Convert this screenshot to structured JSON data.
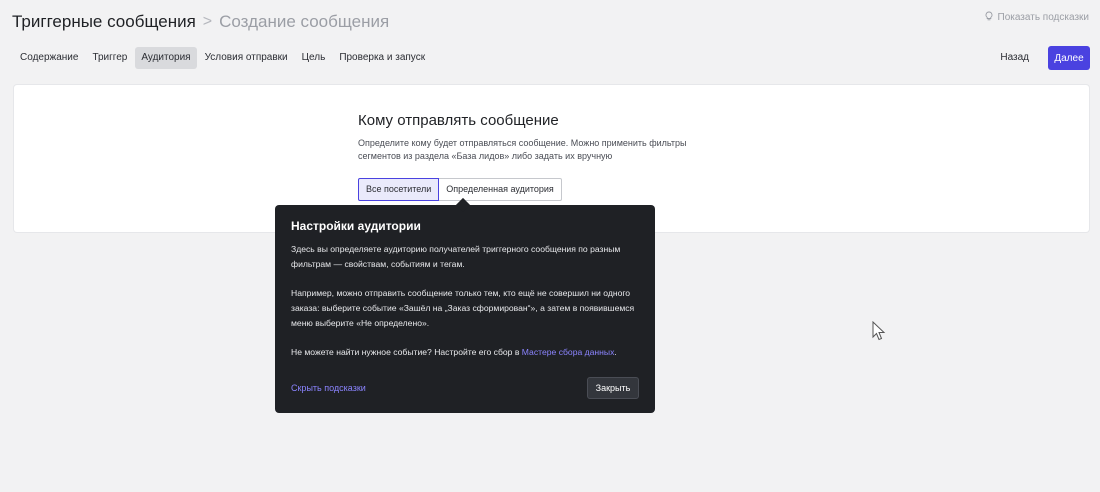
{
  "header": {
    "title": "Триггерные сообщения",
    "separator": ">",
    "subtitle": "Создание сообщения"
  },
  "hints_toggle": {
    "label": "Показать подсказки",
    "icon": "lightbulb-icon"
  },
  "tabs": [
    {
      "label": "Содержание"
    },
    {
      "label": "Триггер"
    },
    {
      "label": "Аудитория",
      "active": true
    },
    {
      "label": "Условия отправки"
    },
    {
      "label": "Цель"
    },
    {
      "label": "Проверка и запуск"
    }
  ],
  "nav": {
    "back_label": "Назад",
    "next_label": "Далее"
  },
  "section": {
    "title": "Кому отправлять сообщение",
    "description": "Определите кому будет отправляться сообщение. Можно применить фильтры сегментов из раздела «База лидов» либо задать их вручную",
    "options": [
      {
        "label": "Все посетители",
        "selected": true
      },
      {
        "label": "Определенная аудитория",
        "selected": false
      }
    ]
  },
  "popover": {
    "title": "Настройки аудитории",
    "para1": "Здесь вы определяете аудиторию получателей триггерного сообщения по разным фильтрам — свойствам, событиям и тегам.",
    "para2": "Например, можно отправить сообщение только тем, кто ещё не совершил ни одного заказа: выберите событие «Зашёл на „Заказ сформирован“», а затем в появившемся меню выберите «Не определено».",
    "para3_prefix": "Не можете найти нужное событие? Настройте его сбор в ",
    "para3_link": "Мастере сбора данных",
    "para3_suffix": ".",
    "hide_label": "Скрыть подсказки",
    "close_label": "Закрыть"
  },
  "colors": {
    "accent": "#4a42e0",
    "link": "#8b84ff",
    "popover_bg": "#1f2125",
    "page_bg": "#f2f2f3"
  }
}
